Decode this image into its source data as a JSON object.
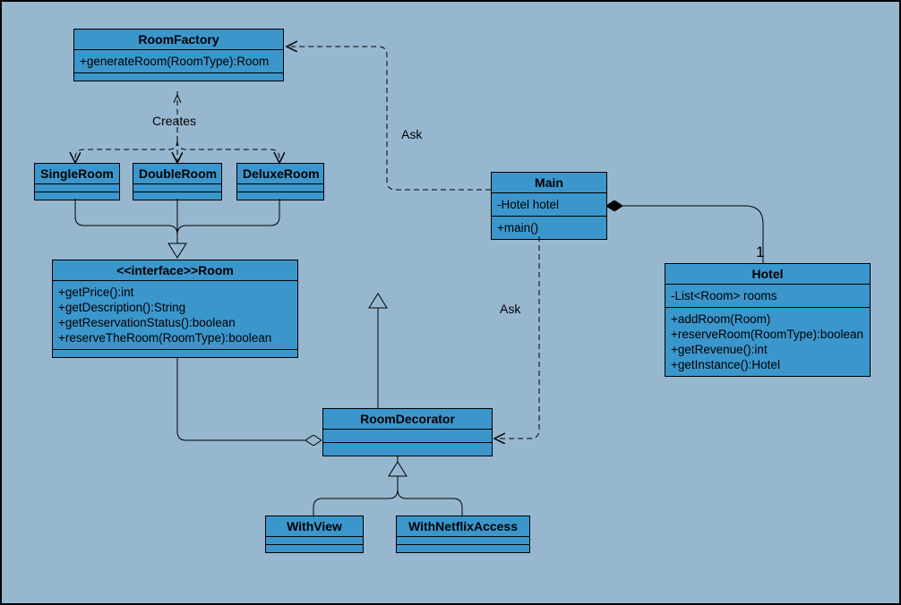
{
  "diagram_type": "UML Class Diagram",
  "chart_data": {
    "type": "uml_class_diagram",
    "classes": [
      {
        "id": "RoomFactory",
        "name": "RoomFactory",
        "attributes": [],
        "methods": [
          "+generateRoom(RoomType):Room"
        ]
      },
      {
        "id": "SingleRoom",
        "name": "SingleRoom",
        "attributes": [],
        "methods": []
      },
      {
        "id": "DoubleRoom",
        "name": "DoubleRoom",
        "attributes": [],
        "methods": []
      },
      {
        "id": "DeluxeRoom",
        "name": "DeluxeRoom",
        "attributes": [],
        "methods": []
      },
      {
        "id": "Main",
        "name": "Main",
        "attributes": [
          "-Hotel hotel"
        ],
        "methods": [
          "+main()"
        ]
      },
      {
        "id": "Hotel",
        "name": "Hotel",
        "attributes": [
          "-List<Room> rooms"
        ],
        "methods": [
          "+addRoom(Room)",
          "+reserveRoom(RoomType):boolean",
          "+getRevenue():int",
          "+getInstance():Hotel"
        ]
      },
      {
        "id": "Room",
        "name": "<<interface>>Room",
        "attributes": [],
        "methods": [
          "+getPrice():int",
          "+getDescription():String",
          "+getReservationStatus():boolean",
          "+reserveTheRoom(RoomType):boolean"
        ]
      },
      {
        "id": "RoomDecorator",
        "name": "RoomDecorator",
        "attributes": [],
        "methods": []
      },
      {
        "id": "WithView",
        "name": "WithView",
        "attributes": [],
        "methods": []
      },
      {
        "id": "WithNetflixAccess",
        "name": "WithNetflixAccess",
        "attributes": [],
        "methods": []
      }
    ],
    "relationships": [
      {
        "from": "Main",
        "to": "RoomFactory",
        "type": "dependency",
        "label": "Ask"
      },
      {
        "from": "Main",
        "to": "RoomDecorator",
        "type": "dependency",
        "label": "Ask"
      },
      {
        "from": "Main",
        "to": "Hotel",
        "type": "composition",
        "multiplicity": "1"
      },
      {
        "from": "RoomFactory",
        "to": "SingleRoom",
        "type": "dependency",
        "label": "Creates"
      },
      {
        "from": "RoomFactory",
        "to": "DoubleRoom",
        "type": "dependency",
        "label": "Creates"
      },
      {
        "from": "RoomFactory",
        "to": "DeluxeRoom",
        "type": "dependency",
        "label": "Creates"
      },
      {
        "from": "SingleRoom",
        "to": "Room",
        "type": "realization"
      },
      {
        "from": "DoubleRoom",
        "to": "Room",
        "type": "realization"
      },
      {
        "from": "DeluxeRoom",
        "to": "Room",
        "type": "realization"
      },
      {
        "from": "RoomDecorator",
        "to": "Room",
        "type": "realization"
      },
      {
        "from": "RoomDecorator",
        "to": "Room",
        "type": "aggregation"
      },
      {
        "from": "WithView",
        "to": "RoomDecorator",
        "type": "generalization"
      },
      {
        "from": "WithNetflixAccess",
        "to": "RoomDecorator",
        "type": "generalization"
      }
    ]
  },
  "labels": {
    "creates": "Creates",
    "ask1": "Ask",
    "ask2": "Ask",
    "one": "1"
  },
  "boxes": {
    "RoomFactory": {
      "name": "RoomFactory",
      "methods": [
        "+generateRoom(RoomType):Room"
      ]
    },
    "SingleRoom": {
      "name": "SingleRoom"
    },
    "DoubleRoom": {
      "name": "DoubleRoom"
    },
    "DeluxeRoom": {
      "name": "DeluxeRoom"
    },
    "Main": {
      "name": "Main",
      "attrs": [
        "-Hotel hotel"
      ],
      "methods": [
        "+main()"
      ]
    },
    "Hotel": {
      "name": "Hotel",
      "attrs": [
        "-List<Room> rooms"
      ],
      "methods": [
        "+addRoom(Room)",
        "+reserveRoom(RoomType):boolean",
        "+getRevenue():int",
        "+getInstance():Hotel"
      ]
    },
    "Room": {
      "name": "<<interface>>Room",
      "methods": [
        "+getPrice():int",
        "+getDescription():String",
        "+getReservationStatus():boolean",
        "+reserveTheRoom(RoomType):boolean"
      ]
    },
    "RoomDecorator": {
      "name": "RoomDecorator"
    },
    "WithView": {
      "name": "WithView"
    },
    "WithNetflixAccess": {
      "name": "WithNetflixAccess"
    }
  }
}
